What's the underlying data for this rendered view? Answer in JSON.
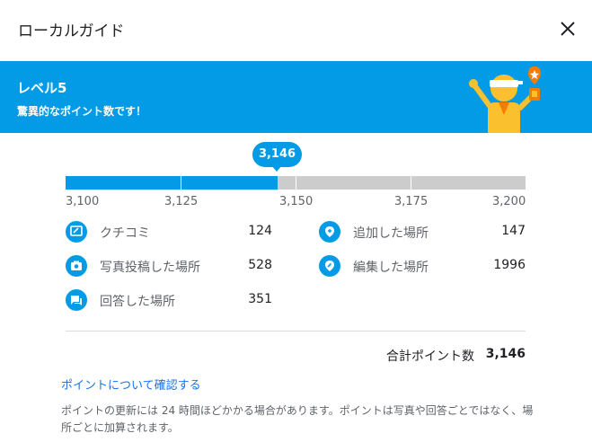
{
  "dialog": {
    "title": "ローカルガイド",
    "close_icon": "close-icon"
  },
  "banner": {
    "background": "#039be5",
    "level": "レベル5",
    "subtitle": "驚異的なポイント数です！"
  },
  "progress": {
    "current_label": "3,146",
    "current": 3146,
    "min": 3100,
    "max": 3200,
    "ticks": [
      "3,100",
      "3,125",
      "3,150",
      "3,175",
      "3,200"
    ]
  },
  "stats": [
    {
      "icon": "review-icon",
      "label": "クチコミ",
      "value": "124"
    },
    {
      "icon": "add-place-icon",
      "label": "追加した場所",
      "value": "147"
    },
    {
      "icon": "camera-icon",
      "label": "写真投稿した場所",
      "value": "528"
    },
    {
      "icon": "edit-place-icon",
      "label": "編集した場所",
      "value": "1996"
    },
    {
      "icon": "answer-icon",
      "label": "回答した場所",
      "value": "351"
    }
  ],
  "total": {
    "label": "合計ポイント数",
    "value": "3,146"
  },
  "link": "ポイントについて確認する",
  "note": "ポイントの更新には 24 時間ほどかかる場合があります。ポイントは写真や回答ごとではなく、場所ごとに加算されます。"
}
